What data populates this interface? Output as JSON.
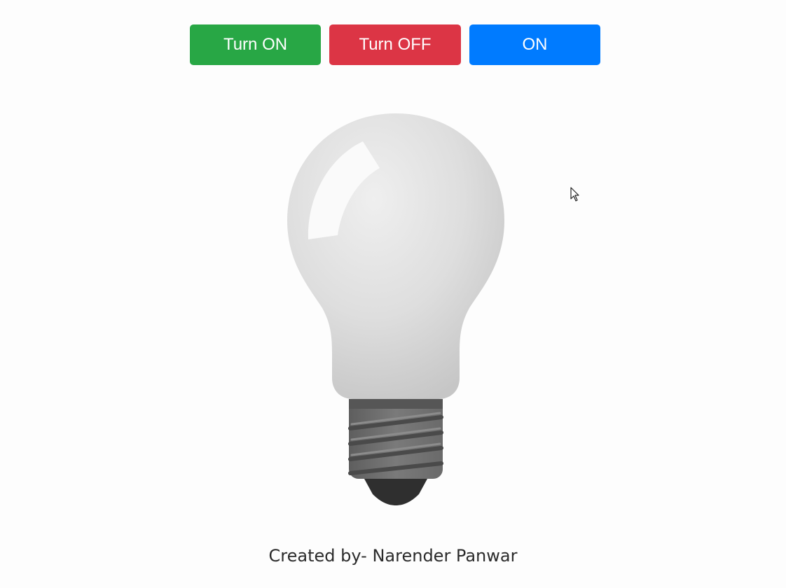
{
  "buttons": {
    "turn_on": {
      "label": "Turn ON",
      "color": "#28a745"
    },
    "turn_off": {
      "label": "Turn OFF",
      "color": "#dc3545"
    },
    "status": {
      "label": "ON",
      "color": "#007bff"
    }
  },
  "bulb": {
    "state": "off",
    "glass_color": "#dcdcdc",
    "base_color": "#6f6f6f",
    "tip_color": "#2f2f2f"
  },
  "footer": {
    "credit": "Created by- Narender Panwar"
  },
  "icons": {
    "cursor": "mouse-pointer-icon"
  }
}
